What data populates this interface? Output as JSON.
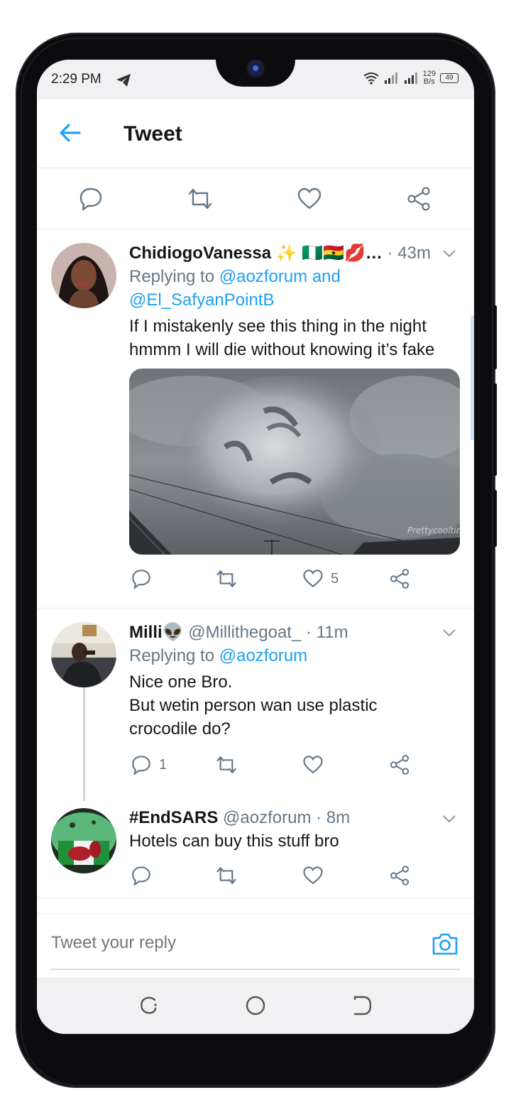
{
  "status_bar": {
    "time": "2:29 PM",
    "net_speed_value": "129",
    "net_speed_unit": "B/s",
    "battery": "49",
    "icons": [
      "telegram-icon",
      "wifi-icon",
      "signal-icon",
      "signal-icon",
      "battery-icon"
    ]
  },
  "header": {
    "back_icon": "arrow-left-icon",
    "title": "Tweet"
  },
  "colors": {
    "accent": "#1da1f2",
    "secondary_text": "#657786",
    "primary_text": "#14171a",
    "divider": "#e6ecf0"
  },
  "main_actions": [
    "reply-icon",
    "retweet-icon",
    "like-icon",
    "share-icon"
  ],
  "tweets": [
    {
      "name": "ChidiogoVanessa ✨ 🇳🇬🇬🇭💋…",
      "handle": "",
      "time": "· 43m",
      "reply_prefix": "Replying to",
      "reply_targets": "@aozforum and",
      "reply_targets_2": "@El_SafyanPointB",
      "text_line1": "If I mistakenly see this thing in the night",
      "text_line2": "hmmm I will die without knowing it’s fake",
      "media_watermark": "Prettycooltim",
      "reply_count": "",
      "retweet_count": "",
      "like_count": "5"
    },
    {
      "name": "Milli👽",
      "handle": "@Millithegoat_",
      "time": "· 11m",
      "reply_prefix": "Replying to",
      "reply_targets": "@aozforum",
      "text_line1": "Nice one Bro.",
      "text_line2": "But wetin person wan use plastic",
      "text_line3": "crocodile do?",
      "reply_count": "1",
      "retweet_count": "",
      "like_count": ""
    },
    {
      "name": "#EndSARS",
      "handle": "@aozforum",
      "time": "· 8m",
      "text_line1": "Hotels can buy this stuff bro",
      "reply_count": "",
      "retweet_count": "",
      "like_count": ""
    }
  ],
  "compose": {
    "placeholder": "Tweet your reply",
    "camera_icon": "camera-icon"
  },
  "nav": [
    "recents-icon",
    "home-icon",
    "back-icon"
  ]
}
